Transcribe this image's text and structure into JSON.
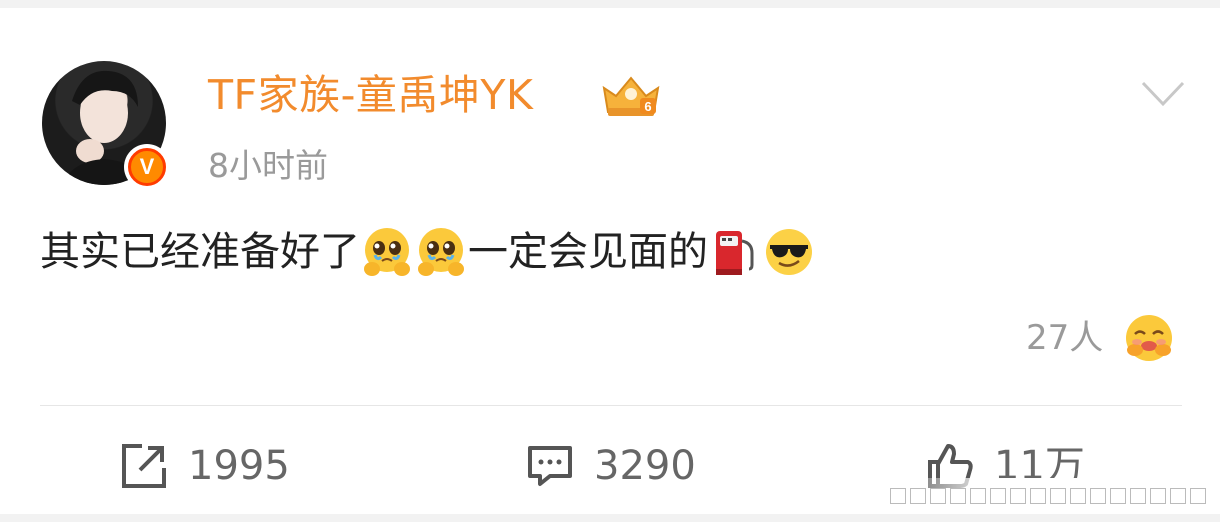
{
  "post": {
    "username": "TF家族-童禹坤YK",
    "timestamp": "8小时前",
    "text_part1": "其实已经准备好了",
    "text_part2": "一定会见面的",
    "emojis": [
      "pleading-face-icon",
      "pleading-face-icon",
      "fuel-pump-icon",
      "sunglasses-face-icon"
    ],
    "reaction_count": "27人"
  },
  "actions": {
    "repost_count": "1995",
    "comment_count": "3290",
    "like_count": "11万"
  },
  "colors": {
    "username": "#f28b2d",
    "secondary_text": "#9a9a9a",
    "verified_badge": "#ff8a00"
  },
  "badge": {
    "verified_letter": "V",
    "crown_level": "6"
  }
}
